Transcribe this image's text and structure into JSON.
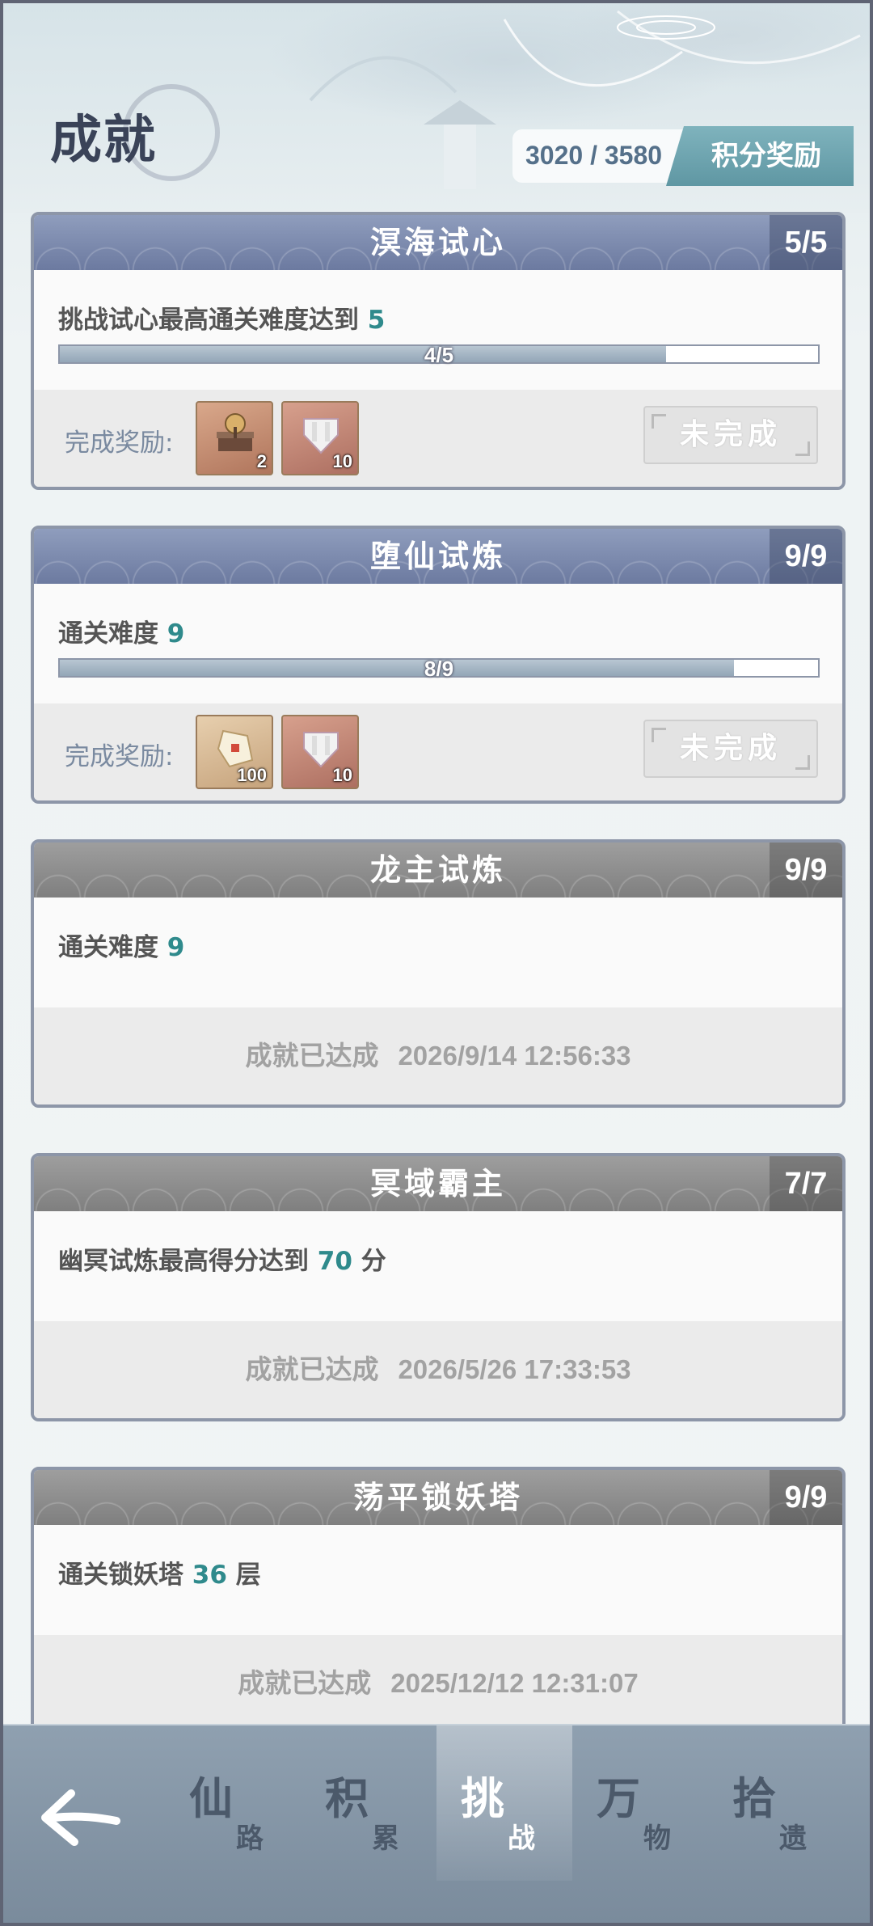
{
  "header": {
    "title": "成就",
    "score": "3020 / 3580",
    "reward_button": "积分奖励"
  },
  "achievements": [
    {
      "title": "溟海试心",
      "count": "5/5",
      "desc_prefix": "挑战试心最高通关难度达到 ",
      "desc_value": "5",
      "desc_suffix": "",
      "progress_text": "4/5",
      "progress": 0.8,
      "reward_label": "完成奖励:",
      "rewards": [
        {
          "icon": "treasure-box-icon",
          "qty": "2"
        },
        {
          "icon": "seal-scroll-icon",
          "qty": "10"
        }
      ],
      "status_button": "未完成"
    },
    {
      "title": "堕仙试炼",
      "count": "9/9",
      "desc_prefix": "通关难度 ",
      "desc_value": "9",
      "desc_suffix": "",
      "progress_text": "8/9",
      "progress": 0.889,
      "reward_label": "完成奖励:",
      "rewards": [
        {
          "icon": "jade-token-icon",
          "qty": "100"
        },
        {
          "icon": "seal-scroll-icon",
          "qty": "10"
        }
      ],
      "status_button": "未完成"
    },
    {
      "title": "龙主试炼",
      "count": "9/9",
      "desc_prefix": "通关难度 ",
      "desc_value": "9",
      "desc_suffix": "",
      "done_label": "成就已达成",
      "done_date": "2026/9/14 12:56:33"
    },
    {
      "title": "冥域霸主",
      "count": "7/7",
      "desc_prefix": "幽冥试炼最高得分达到 ",
      "desc_value": "70",
      "desc_suffix": " 分",
      "done_label": "成就已达成",
      "done_date": "2026/5/26 17:33:53"
    },
    {
      "title": "荡平锁妖塔",
      "count": "9/9",
      "desc_prefix": "通关锁妖塔 ",
      "desc_value": "36",
      "desc_suffix": " 层",
      "done_label": "成就已达成",
      "done_date": "2025/12/12 12:31:07"
    }
  ],
  "nav": {
    "back_icon": "back-arrow-icon",
    "tabs": [
      {
        "main": "仙",
        "sub": "路"
      },
      {
        "main": "积",
        "sub": "累"
      },
      {
        "main": "挑",
        "sub": "战",
        "active": true
      },
      {
        "main": "万",
        "sub": "物"
      },
      {
        "main": "拾",
        "sub": "遗"
      }
    ]
  },
  "colors": {
    "accent_teal": "#2f8a8c",
    "card_head_active": "#7b88ab",
    "card_head_done": "#8c8c8c"
  }
}
